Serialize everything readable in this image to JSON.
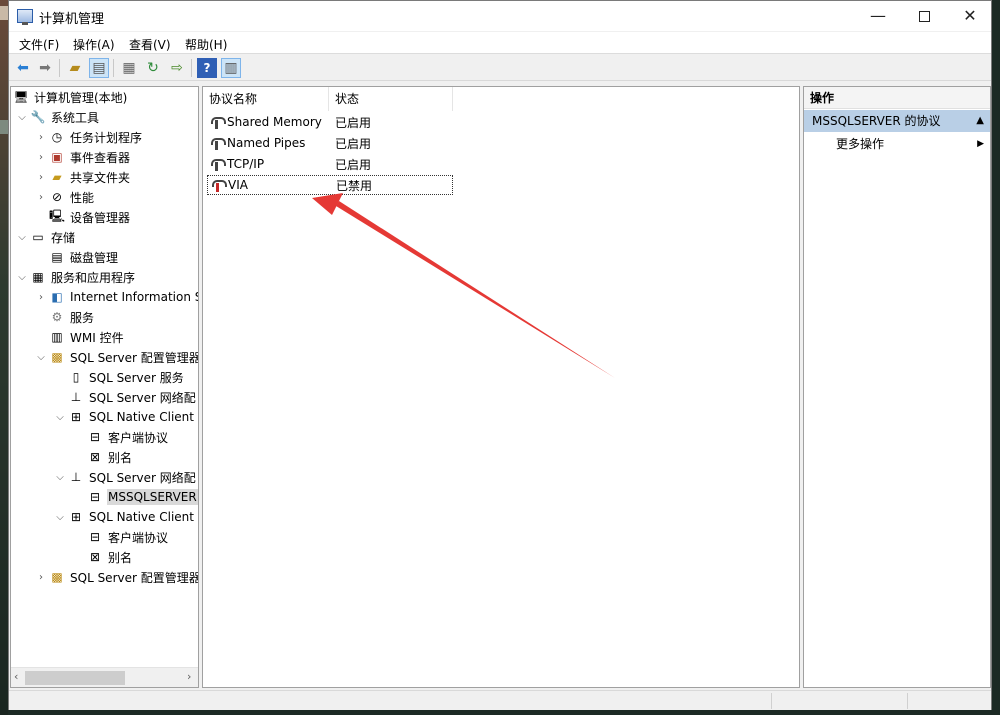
{
  "window": {
    "title": "计算机管理",
    "controls": {
      "minimize": "—",
      "maximize": "",
      "close": "✕"
    }
  },
  "menu": [
    "文件(F)",
    "操作(A)",
    "查看(V)",
    "帮助(H)"
  ],
  "toolbar_icons": [
    "back-arrow-icon",
    "forward-arrow-icon",
    "up-folder-icon",
    "show-hide-tree-icon",
    "properties-icon",
    "refresh-icon",
    "export-list-icon",
    "help-icon",
    "show-action-pane-icon"
  ],
  "tree": [
    {
      "label": "计算机管理(本地)",
      "icon": "computer-icon",
      "expander": ""
    },
    {
      "label": "系统工具",
      "icon": "tools-icon",
      "expander": "v"
    },
    {
      "label": "任务计划程序",
      "icon": "clock-icon",
      "expander": ">"
    },
    {
      "label": "事件查看器",
      "icon": "event-viewer-icon",
      "expander": ">"
    },
    {
      "label": "共享文件夹",
      "icon": "shared-folder-icon",
      "expander": ">"
    },
    {
      "label": "性能",
      "icon": "performance-icon",
      "expander": ">"
    },
    {
      "label": "设备管理器",
      "icon": "device-manager-icon",
      "expander": ""
    },
    {
      "label": "存储",
      "icon": "storage-icon",
      "expander": "v"
    },
    {
      "label": "磁盘管理",
      "icon": "disk-icon",
      "expander": ""
    },
    {
      "label": "服务和应用程序",
      "icon": "services-apps-icon",
      "expander": "v"
    },
    {
      "label": "Internet Information S",
      "icon": "iis-icon",
      "expander": ">"
    },
    {
      "label": "服务",
      "icon": "gear-icon",
      "expander": ""
    },
    {
      "label": "WMI 控件",
      "icon": "wmi-icon",
      "expander": ""
    },
    {
      "label": "SQL Server 配置管理器",
      "icon": "sql-config-icon",
      "expander": "v"
    },
    {
      "label": "SQL Server 服务",
      "icon": "server-icon",
      "expander": ""
    },
    {
      "label": "SQL Server 网络配",
      "icon": "network-icon",
      "expander": ""
    },
    {
      "label": "SQL Native Client",
      "icon": "client-icon",
      "expander": "v"
    },
    {
      "label": "客户端协议",
      "icon": "protocol-icon",
      "expander": ""
    },
    {
      "label": "别名",
      "icon": "alias-icon",
      "expander": ""
    },
    {
      "label": "SQL Server 网络配",
      "icon": "network-icon",
      "expander": "v"
    },
    {
      "label": "MSSQLSERVER",
      "icon": "protocol-icon",
      "expander": ""
    },
    {
      "label": "SQL Native Client",
      "icon": "client-icon",
      "expander": "v"
    },
    {
      "label": "客户端协议",
      "icon": "protocol-icon",
      "expander": ""
    },
    {
      "label": "别名",
      "icon": "alias-icon",
      "expander": ""
    },
    {
      "label": "SQL Server 配置管理器",
      "icon": "sql-config-icon",
      "expander": ">"
    }
  ],
  "list": {
    "columns": [
      "协议名称",
      "状态"
    ],
    "rows": [
      {
        "name": "Shared Memory",
        "status": "已启用"
      },
      {
        "name": "Named Pipes",
        "status": "已启用"
      },
      {
        "name": "TCP/IP",
        "status": "已启用"
      },
      {
        "name": "VIA",
        "status": "已禁用"
      }
    ]
  },
  "actions": {
    "title": "操作",
    "group": "MSSQLSERVER 的协议",
    "more": "更多操作"
  },
  "colors": {
    "annotation_arrow": "#e53935",
    "selected_group_bg": "#b9cfe6"
  }
}
